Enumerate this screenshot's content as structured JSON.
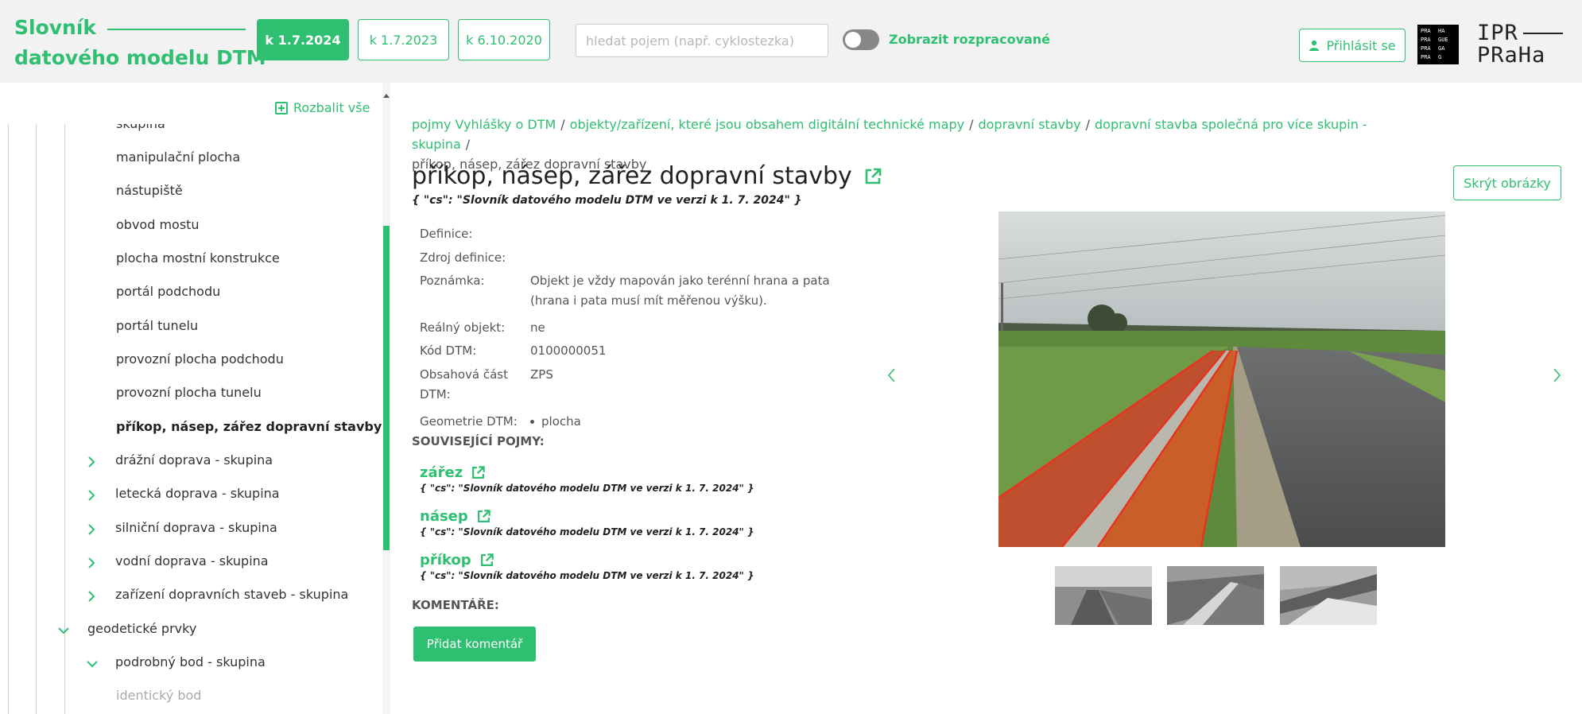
{
  "header": {
    "brand_line1": "Slovník",
    "brand_line2": "datového modelu DTM",
    "date_buttons": [
      "k 1.7.2024",
      "k 1.7.2023",
      "k 6.10.2020"
    ],
    "search_placeholder": "hledat pojem (např. cyklostezka)",
    "toggle_label": "Zobrazit rozpracované",
    "login_label": "Přihlásit se",
    "praha_logo": [
      "PRA",
      "HA",
      "PRA",
      "GUE",
      "PRA",
      "GA",
      "PRA",
      "G"
    ],
    "ipr_logo_top": "IPR",
    "ipr_logo_bottom": "PRaHa"
  },
  "sidebar": {
    "expand_all": "Rozbalit vše",
    "items": [
      "skupina",
      "manipulační plocha",
      "nástupiště",
      "obvod mostu",
      "plocha mostní konstrukce",
      "portál podchodu",
      "portál tunelu",
      "provozní plocha podchodu",
      "provozní plocha tunelu",
      "příkop, násep, zářez dopravní stavby",
      "drážní doprava - skupina",
      "letecká doprava - skupina",
      "silniční doprava - skupina",
      "vodní doprava - skupina",
      "zařízení dopravních staveb - skupina",
      "geodetické prvky",
      "podrobný bod - skupina",
      "identický bod"
    ]
  },
  "breadcrumb": {
    "items": [
      "pojmy Vyhlášky o DTM",
      "objekty/zařízení, které jsou obsahem digitální technické mapy",
      "dopravní stavby",
      "dopravní stavba společná pro více skupin - skupina"
    ],
    "current": "příkop, násep, zářez dopravní stavby"
  },
  "term": {
    "title": "příkop, násep, zářez dopravní stavby",
    "subtitle": "{ \"cs\": \"Slovník datového modelu DTM ve verzi k 1. 7. 2024\" }",
    "props": [
      {
        "label": "Definice:",
        "value": ""
      },
      {
        "label": "Zdroj definice:",
        "value": ""
      },
      {
        "label": "Poznámka:",
        "value": "Objekt je vždy mapován jako terénní hrana a pata (hrana i pata musí mít měřenou výšku)."
      },
      {
        "label": "Reálný objekt:",
        "value": "ne"
      },
      {
        "label": "Kód DTM:",
        "value": "0100000051"
      },
      {
        "label": "Obsahová část DTM:",
        "value": "ZPS"
      },
      {
        "label": "Geometrie DTM:",
        "value": "plocha"
      }
    ]
  },
  "related": {
    "heading": "SOUVISEJÍCÍ POJMY:",
    "items": [
      {
        "name": "zářez",
        "sub": "{ \"cs\": \"Slovník datového modelu DTM ve verzi k 1. 7. 2024\" }"
      },
      {
        "name": "násep",
        "sub": "{ \"cs\": \"Slovník datového modelu DTM ve verzi k 1. 7. 2024\" }"
      },
      {
        "name": "příkop",
        "sub": "{ \"cs\": \"Slovník datového modelu DTM ve verzi k 1. 7. 2024\" }"
      }
    ]
  },
  "comments": {
    "heading": "KOMENTÁŘE:",
    "add_label": "Přidat komentář"
  },
  "gallery": {
    "hide_label": "Skrýt obrázky"
  },
  "colors": {
    "accent": "#2fbf71",
    "highlight": "#e8321e"
  }
}
